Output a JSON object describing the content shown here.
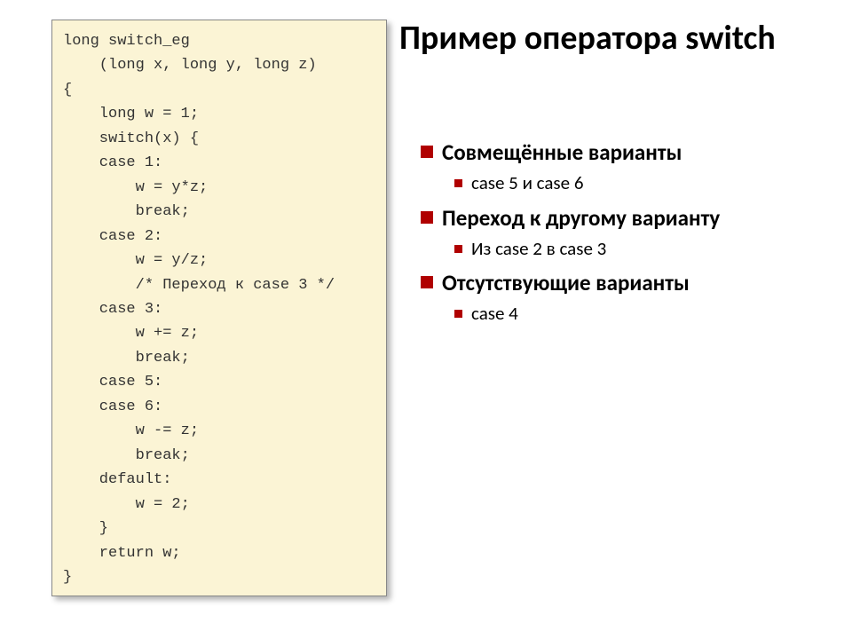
{
  "code": "long switch_eg\n    (long x, long y, long z)\n{\n    long w = 1;\n    switch(x) {\n    case 1:\n        w = y*z;\n        break;\n    case 2:\n        w = y/z;\n        /* Переход к case 3 */\n    case 3:\n        w += z;\n        break;\n    case 5:\n    case 6:\n        w -= z;\n        break;\n    default:\n        w = 2;\n    }\n    return w;\n}",
  "title": "Пример оператора switch",
  "bullets": {
    "b1": {
      "text": "Совмещённые варианты",
      "sub": "case 5 и case 6"
    },
    "b2": {
      "text": "Переход к другому варианту",
      "sub": "Из case 2 в case 3"
    },
    "b3": {
      "text": "Отсутствующие варианты",
      "sub": "case 4"
    }
  }
}
